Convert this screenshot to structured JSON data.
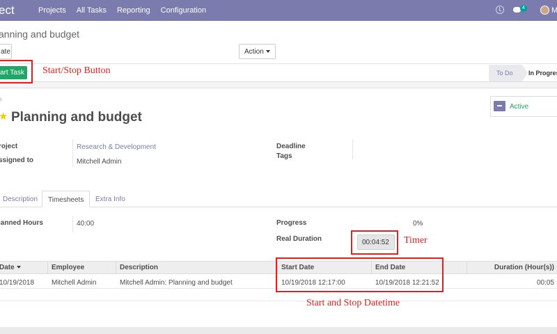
{
  "navbar": {
    "brand": "ect",
    "menu": [
      "Projects",
      "All Tasks",
      "Reporting",
      "Configuration"
    ],
    "chat_count": "4",
    "user_initial": "M"
  },
  "control_panel": {
    "breadcrumb": "anning and budget",
    "create_label": "ate",
    "action_label": "Action"
  },
  "statusbar": {
    "start_button": "art Task",
    "stages": [
      "To Do",
      "In Progress"
    ]
  },
  "annotations": {
    "start_stop": "Start/Stop Button",
    "timer": "Timer",
    "datetime": "Start and Stop Datetime"
  },
  "task": {
    "title": "Planning and budget",
    "active_label": "Active",
    "fields": {
      "project_label": "roject",
      "project_value": "Research & Development",
      "assigned_label": "ssigned to",
      "assigned_value": "Mitchell Admin",
      "deadline_label": "Deadline",
      "tags_label": "Tags"
    }
  },
  "tabs": [
    "Description",
    "Timesheets",
    "Extra Info"
  ],
  "timesheet": {
    "planned_label": "lanned Hours",
    "planned_value": "40:00",
    "progress_label": "Progress",
    "progress_value": "0%",
    "real_label": "Real Duration",
    "real_value": "00:04:52",
    "columns": [
      "Date",
      "Employee",
      "Description",
      "Start Date",
      "End Date",
      "Duration (Hour(s))"
    ],
    "rows": [
      {
        "date": "10/19/2018",
        "employee": "Mitchell Admin",
        "description": "Mitchell Admin: Planning and budget",
        "start": "10/19/2018 12:17:00",
        "end": "10/19/2018 12:21:52",
        "duration": "00:05"
      }
    ]
  },
  "colors": {
    "navbar": "#7c7bad",
    "start_button": "#1fa765",
    "annotation": "#e51e1e",
    "active": "#21a265"
  }
}
